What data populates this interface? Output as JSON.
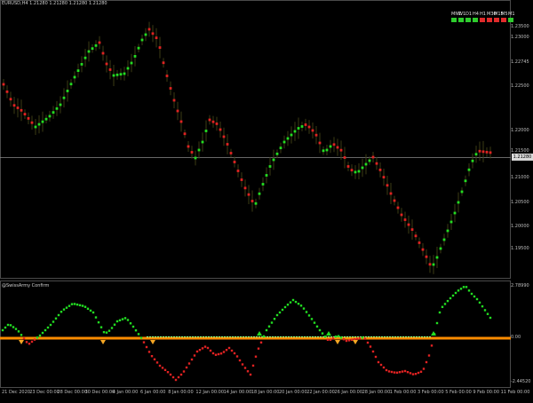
{
  "header": {
    "symbol_info": "EURUSD,H4  1.21280 1.21280 1.21280 1.21280"
  },
  "indicator_title": "@SwissArmy Confirm",
  "timeframes": [
    {
      "label": "MN1",
      "color": "#2ecc2e"
    },
    {
      "label": "W1",
      "color": "#2ecc2e"
    },
    {
      "label": "D1",
      "color": "#2ecc2e"
    },
    {
      "label": "H4",
      "color": "#2ecc2e"
    },
    {
      "label": "H1",
      "color": "#e02b2b"
    },
    {
      "label": "M30",
      "color": "#e02b2b"
    },
    {
      "label": "M15",
      "color": "#e02b2b"
    },
    {
      "label": "M5",
      "color": "#e02b2b"
    },
    {
      "label": "M1",
      "color": "#2ecc2e"
    }
  ],
  "price_axis": [
    "1.23500",
    "1.23000",
    "1.22745",
    "1.22500",
    "1.22000",
    "1.21500",
    "1.21000",
    "1.20500",
    "1.20000",
    "1.19500"
  ],
  "current_price": "1.21280",
  "indicator_axis": [
    "2.78990",
    "0.00",
    "-2.44520"
  ],
  "time_axis": [
    "21 Dec 2020",
    "23 Dec 00:00",
    "28 Dec 00:00",
    "30 Dec 00:00",
    "4 Jan 00:00",
    "6 Jan 00:00",
    "8 Jan 00:00",
    "12 Jan 00:00",
    "14 Jan 00:00",
    "18 Jan 00:00",
    "20 Jan 00:00",
    "22 Jan 00:00",
    "26 Jan 00:00",
    "28 Jan 00:00",
    "1 Feb 00:00",
    "3 Feb 00:00",
    "5 Feb 00:00",
    "9 Feb 00:00",
    "11 Feb 00:00"
  ],
  "colors": {
    "bull": "#22dd22",
    "bear": "#e02222",
    "baseline": "#ff8c00",
    "signal_line": "#88ff88",
    "arrow": "#f5a623"
  }
}
